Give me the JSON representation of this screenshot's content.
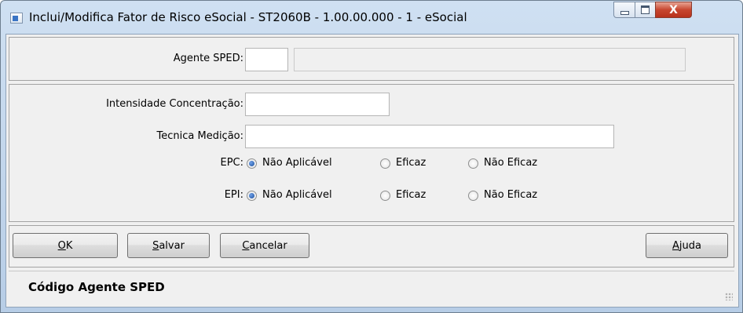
{
  "window": {
    "title": "Inclui/Modifica Fator de Risco eSocial - ST2060B - 1.00.00.000 - 1 - eSocial",
    "close_glyph": "X"
  },
  "agente": {
    "label": "Agente SPED:",
    "code_value": "",
    "description_value": ""
  },
  "fields": {
    "intensidade_label": "Intensidade Concentração:",
    "intensidade_value": "",
    "tecnica_label": "Tecnica Medição:",
    "tecnica_value": ""
  },
  "epc": {
    "label": "EPC:",
    "options": [
      "Não Aplicável",
      "Eficaz",
      "Não Eficaz"
    ],
    "selected": "Não Aplicável"
  },
  "epi": {
    "label": "EPI:",
    "options": [
      "Não Aplicável",
      "Eficaz",
      "Não Eficaz"
    ],
    "selected": "Não Aplicável"
  },
  "buttons": {
    "ok": {
      "label": "OK",
      "mnemonic": "O"
    },
    "salvar": {
      "label": "Salvar",
      "mnemonic": "S"
    },
    "cancelar": {
      "label": "Cancelar",
      "mnemonic": "C"
    },
    "ajuda": {
      "label": "Ajuda",
      "mnemonic": "A"
    }
  },
  "status": {
    "text": "Código Agente SPED"
  },
  "icons": [
    "app-icon",
    "minimize-icon",
    "maximize-icon",
    "close-icon",
    "resize-grip-icon"
  ]
}
